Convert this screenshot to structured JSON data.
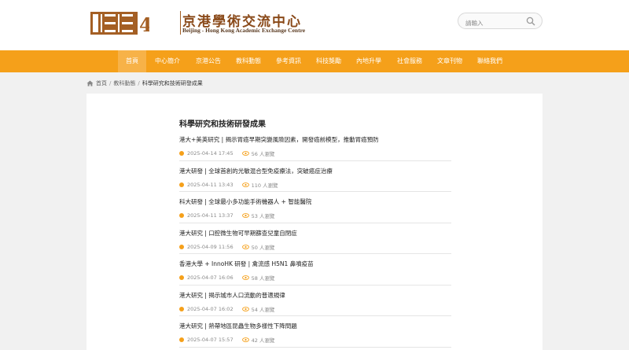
{
  "logo": {
    "name_cn": "京港學術交流中心",
    "name_en": "Beijing - Hong Kong Academic Exchange Centre",
    "anniversary": "40"
  },
  "search": {
    "placeholder": "請輸入"
  },
  "nav": {
    "items": [
      {
        "label": "首頁",
        "active": true
      },
      {
        "label": "中心簡介"
      },
      {
        "label": "京港公告"
      },
      {
        "label": "教科動態"
      },
      {
        "label": "參考資訊"
      },
      {
        "label": "科技獎勵"
      },
      {
        "label": "內地升學"
      },
      {
        "label": "社會服務"
      },
      {
        "label": "文章刊物"
      },
      {
        "label": "聯絡我們"
      }
    ]
  },
  "breadcrumb": {
    "home": "首頁",
    "section": "教科動態",
    "current": "科學研究和技術研發成果"
  },
  "list": {
    "title": "科學研究和技術研發成果",
    "items": [
      {
        "title": "港大+美英研究 | 揭示胃癌早期突變風險因素，開發癌前模型，推動胃癌預防",
        "date": "2025-04-14 17:45",
        "views": "56 人瀏覽"
      },
      {
        "title": "港大研發 | 全球首創的光敏混合型免疫療法，突破癌症治療",
        "date": "2025-04-11 13:43",
        "views": "110 人瀏覽"
      },
      {
        "title": "科大研發 | 全球最小多功能手術機器人 + 智能醫院",
        "date": "2025-04-11 13:37",
        "views": "53 人瀏覽"
      },
      {
        "title": "港大研究 | 口腔微生物可早期篩查兒童自閉症",
        "date": "2025-04-09 11:56",
        "views": "50 人瀏覽"
      },
      {
        "title": "香港大學 + InnoHK 研發 | 禽流感 H5N1 鼻噴疫苗",
        "date": "2025-04-07 16:06",
        "views": "58 人瀏覽"
      },
      {
        "title": "港大研究 | 揭示城市人口流動的普適規律",
        "date": "2025-04-07 16:02",
        "views": "54 人瀏覽"
      },
      {
        "title": "港大研究 | 熱帶地區昆蟲生物多樣性下降問題",
        "date": "2025-04-07 15:57",
        "views": "42 人瀏覽"
      }
    ]
  },
  "colors": {
    "accent": "#f5a01a",
    "brand": "#8a4a1a"
  },
  "icons": {
    "search": "search-icon",
    "home": "home-icon",
    "views": "eye-icon",
    "date": "clock-dot-icon"
  }
}
